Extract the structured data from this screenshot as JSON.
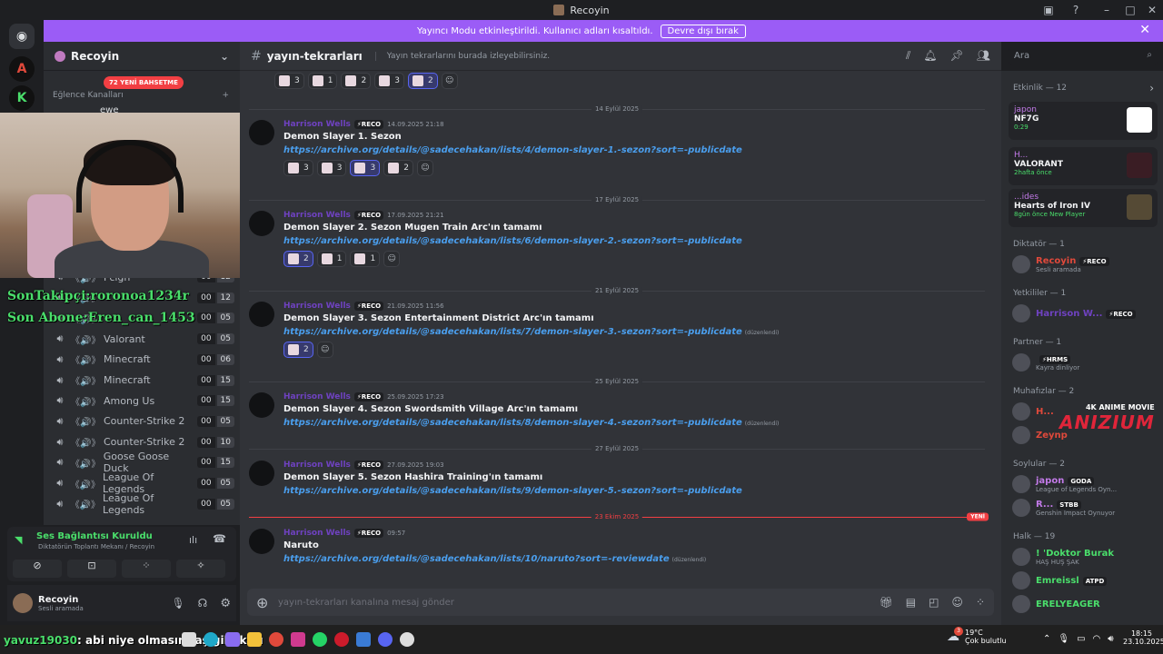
{
  "window": {
    "title": "Recoyin"
  },
  "banner": {
    "text": "Yayıncı Modu etkinleştirildi. Kullanıcı adları kısaltıldı.",
    "button": "Devre dışı bırak"
  },
  "server": {
    "name": "Recoyin",
    "new_badge": "72 YENİ BAHSETME",
    "category": "Eğlence Kanalları",
    "partial_channel": "ewe"
  },
  "voice_channels": [
    {
      "label": "Fcign",
      "a": "00",
      "b": "12"
    },
    {
      "label": "",
      "a": "00",
      "b": "12"
    },
    {
      "label": "",
      "a": "00",
      "b": "05"
    },
    {
      "label": "Valorant",
      "a": "00",
      "b": "05"
    },
    {
      "label": "Minecraft",
      "a": "00",
      "b": "06"
    },
    {
      "label": "Minecraft",
      "a": "00",
      "b": "15"
    },
    {
      "label": "Among Us",
      "a": "00",
      "b": "15"
    },
    {
      "label": "Counter-Strike 2",
      "a": "00",
      "b": "05"
    },
    {
      "label": "Counter-Strike 2",
      "a": "00",
      "b": "10"
    },
    {
      "label": "Goose Goose Duck",
      "a": "00",
      "b": "15"
    },
    {
      "label": "League Of Legends",
      "a": "00",
      "b": "05"
    },
    {
      "label": "League Of Legends",
      "a": "00",
      "b": "05"
    }
  ],
  "overlay": {
    "last_follower": "SonTakipçi:roronoa1234r",
    "last_sub": "Son Abone:Eren_can_1453",
    "chat_line_user": "yavuz19030",
    "chat_line_text": ": abi niye olmasın taş gibi karı"
  },
  "voice_panel": {
    "status": "Ses Bağlantısı Kuruldu",
    "location": "Diktatörün Toplantı Mekanı / Recoyin"
  },
  "user_panel": {
    "name": "Recoyin",
    "status": "Sesli aramada"
  },
  "channel": {
    "name": "yayın-tekrarları",
    "topic": "Yayın tekrarlarını burada izleyebilirsiniz.",
    "composer_placeholder": "yayın-tekrarları kanalına mesaj gönder"
  },
  "search": {
    "placeholder": "Ara"
  },
  "top_reactions": [
    {
      "count": "3",
      "active": false
    },
    {
      "count": "1",
      "active": false
    },
    {
      "count": "2",
      "active": false
    },
    {
      "count": "3",
      "active": false
    },
    {
      "count": "2",
      "active": true
    }
  ],
  "messages": [
    {
      "date": "14 Eylül 2025",
      "author": "Harrison Wells",
      "tag": "⚡RECO",
      "time": "14.09.2025 21:18",
      "title": "Demon Slayer 1. Sezon",
      "link": "https://archive.org/details/@sadecehakan/lists/4/demon-slayer-1.-sezon?sort=-publicdate",
      "edited": "",
      "reactions": [
        {
          "count": "3",
          "active": false
        },
        {
          "count": "3",
          "active": false
        },
        {
          "count": "3",
          "active": true
        },
        {
          "count": "2",
          "active": false
        }
      ]
    },
    {
      "date": "17 Eylül 2025",
      "author": "Harrison Wells",
      "tag": "⚡RECO",
      "time": "17.09.2025 21:21",
      "title": "Demon Slayer 2. Sezon Mugen Train Arc'ın tamamı",
      "link": "https://archive.org/details/@sadecehakan/lists/6/demon-slayer-2.-sezon?sort=-publicdate",
      "edited": "",
      "reactions": [
        {
          "count": "2",
          "active": true
        },
        {
          "count": "1",
          "active": false
        },
        {
          "count": "1",
          "active": false
        }
      ]
    },
    {
      "date": "21 Eylül 2025",
      "author": "Harrison Wells",
      "tag": "⚡RECO",
      "time": "21.09.2025 11:56",
      "title": "Demon Slayer 3. Sezon Entertainment District Arc'ın tamamı",
      "link": "https://archive.org/details/@sadecehakan/lists/7/demon-slayer-3.-sezon?sort=-publicdate",
      "edited": "(düzenlendi)",
      "reactions": [
        {
          "count": "2",
          "active": true
        }
      ]
    },
    {
      "date": "25 Eylül 2025",
      "author": "Harrison Wells",
      "tag": "⚡RECO",
      "time": "25.09.2025 17:23",
      "title": "Demon Slayer 4. Sezon Swordsmith Village Arc'ın tamamı",
      "link": "https://archive.org/details/@sadecehakan/lists/8/demon-slayer-4.-sezon?sort=-publicdate",
      "edited": "(düzenlendi)",
      "reactions": []
    },
    {
      "date": "27 Eylül 2025",
      "author": "Harrison Wells",
      "tag": "⚡RECO",
      "time": "27.09.2025 19:03",
      "title": "Demon Slayer 5. Sezon Hashira Training'ın tamamı",
      "link": "https://archive.org/details/@sadecehakan/lists/9/demon-slayer-5.-sezon?sort=-publicdate",
      "edited": "",
      "reactions": []
    },
    {
      "date": "23 Ekim 2025",
      "author": "Harrison Wells",
      "tag": "⚡RECO",
      "time": "09:57",
      "title": "Naruto",
      "link": "https://archive.org/details/@sadecehakan/lists/10/naruto?sort=-reviewdate",
      "edited": "(düzenlendi)",
      "reactions": []
    }
  ],
  "new_label": "YENİ",
  "members": {
    "activity_header": "Etkinlik — 12",
    "activities": [
      {
        "name": "japon",
        "game": "NF7G",
        "extra": "0:29"
      },
      {
        "name": "H...",
        "game": "VALORANT",
        "extra": "2hafta önce"
      },
      {
        "name": "...ides",
        "game": "Hearts of Iron IV",
        "extra": "8gün önce  New Player"
      }
    ],
    "groups": [
      {
        "title": "Diktatör — 1",
        "members": [
          {
            "name": "Recoyin",
            "tag": "⚡RECO",
            "sub": "Sesli aramada",
            "color": "#e0493b"
          }
        ]
      },
      {
        "title": "Yetkililer — 1",
        "members": [
          {
            "name": "Harrison W...",
            "tag": "⚡RECO",
            "sub": "",
            "color": "#6f42c1"
          }
        ]
      },
      {
        "title": "Partner — 1",
        "members": [
          {
            "name": "",
            "tag": "⚡HRMS",
            "sub": "Kayra dinliyor",
            "color": "#dbdee1"
          }
        ]
      },
      {
        "title": "Muhafızlar — 2",
        "members": [
          {
            "name": "H...",
            "tag": "",
            "sub": "",
            "color": "#e0493b"
          },
          {
            "name": "Zeynp",
            "tag": "",
            "sub": "",
            "color": "#e0493b"
          }
        ]
      },
      {
        "title": "Soylular — 2",
        "members": [
          {
            "name": "japon",
            "tag": "GODA",
            "sub": "League of Legends Oyn...",
            "color": "#c27ae8"
          },
          {
            "name": "R...",
            "tag": "STBB",
            "sub": "Genshin Impact Oynuyor",
            "color": "#c27ae8"
          }
        ]
      },
      {
        "title": "Halk — 19",
        "members": [
          {
            "name": "! 'Doktor Burak",
            "tag": "",
            "sub": "HAŞ HUŞ ŞAK",
            "color": "#4ade6b"
          },
          {
            "name": "Emreissl",
            "tag": "ATPD",
            "sub": "",
            "color": "#4ade6b"
          },
          {
            "name": "ERELYEAGER",
            "tag": "",
            "sub": "",
            "color": "#4ade6b"
          }
        ]
      }
    ],
    "watermark_top": "4K ANIME MOVIE",
    "watermark_brand": "ANIZIUM"
  },
  "taskbar": {
    "weather_temp": "19°C",
    "weather_desc": "Çok bulutlu",
    "weather_badge": "3",
    "time": "18:15",
    "date": "23.10.2025"
  }
}
